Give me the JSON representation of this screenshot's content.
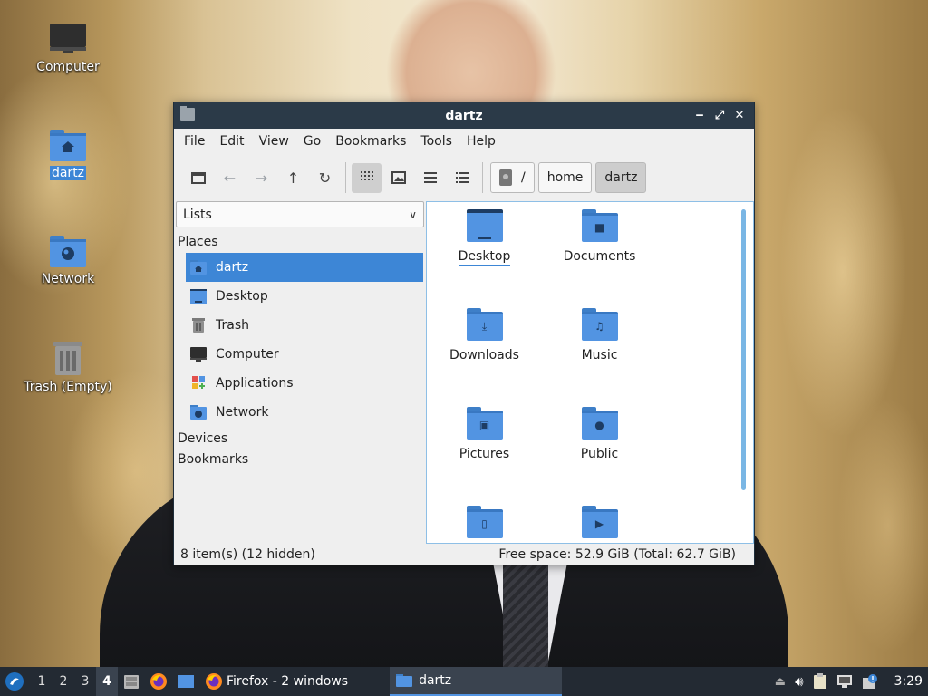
{
  "desktop": {
    "icons": [
      {
        "label": "Computer",
        "icon": "computer-icon"
      },
      {
        "label": "dartz",
        "icon": "home-folder-icon"
      },
      {
        "label": "Network",
        "icon": "network-folder-icon"
      },
      {
        "label": "Trash (Empty)",
        "icon": "trash-icon"
      }
    ]
  },
  "window": {
    "title": "dartz",
    "menu": [
      "File",
      "Edit",
      "View",
      "Go",
      "Bookmarks",
      "Tools",
      "Help"
    ],
    "breadcrumb": {
      "root": "/",
      "parts": [
        "home",
        "dartz"
      ]
    },
    "side_view_mode": "Lists",
    "sections": {
      "places": "Places",
      "devices": "Devices",
      "bookmarks": "Bookmarks"
    },
    "places": [
      {
        "label": "dartz",
        "icon": "home-icon",
        "selected": true
      },
      {
        "label": "Desktop",
        "icon": "desktop-icon"
      },
      {
        "label": "Trash",
        "icon": "trash-icon"
      },
      {
        "label": "Computer",
        "icon": "computer-icon"
      },
      {
        "label": "Applications",
        "icon": "applications-icon"
      },
      {
        "label": "Network",
        "icon": "network-icon"
      }
    ],
    "files": [
      {
        "name": "Desktop",
        "icon": "desktop-folder-icon"
      },
      {
        "name": "Documents",
        "icon": "documents-folder-icon"
      },
      {
        "name": "Downloads",
        "icon": "downloads-folder-icon"
      },
      {
        "name": "Music",
        "icon": "music-folder-icon"
      },
      {
        "name": "Pictures",
        "icon": "pictures-folder-icon"
      },
      {
        "name": "Public",
        "icon": "public-folder-icon"
      },
      {
        "name": "",
        "icon": "templates-folder-icon"
      },
      {
        "name": "",
        "icon": "videos-folder-icon"
      }
    ],
    "status": {
      "items": "8 item(s) (12 hidden)",
      "space": "Free space: 52.9 GiB (Total: 62.7 GiB)"
    }
  },
  "taskbar": {
    "workspaces": [
      "1",
      "2",
      "3",
      "4"
    ],
    "current_workspace": "4",
    "tasks": [
      {
        "label": "Firefox - 2 windows",
        "icon": "firefox-icon"
      },
      {
        "label": "dartz",
        "icon": "folder-icon"
      }
    ],
    "clock": "3:29"
  },
  "colors": {
    "accent": "#3d86d6",
    "titlebar": "#2b3a48",
    "folder": "#5294e2",
    "taskbar": "#232a33"
  }
}
